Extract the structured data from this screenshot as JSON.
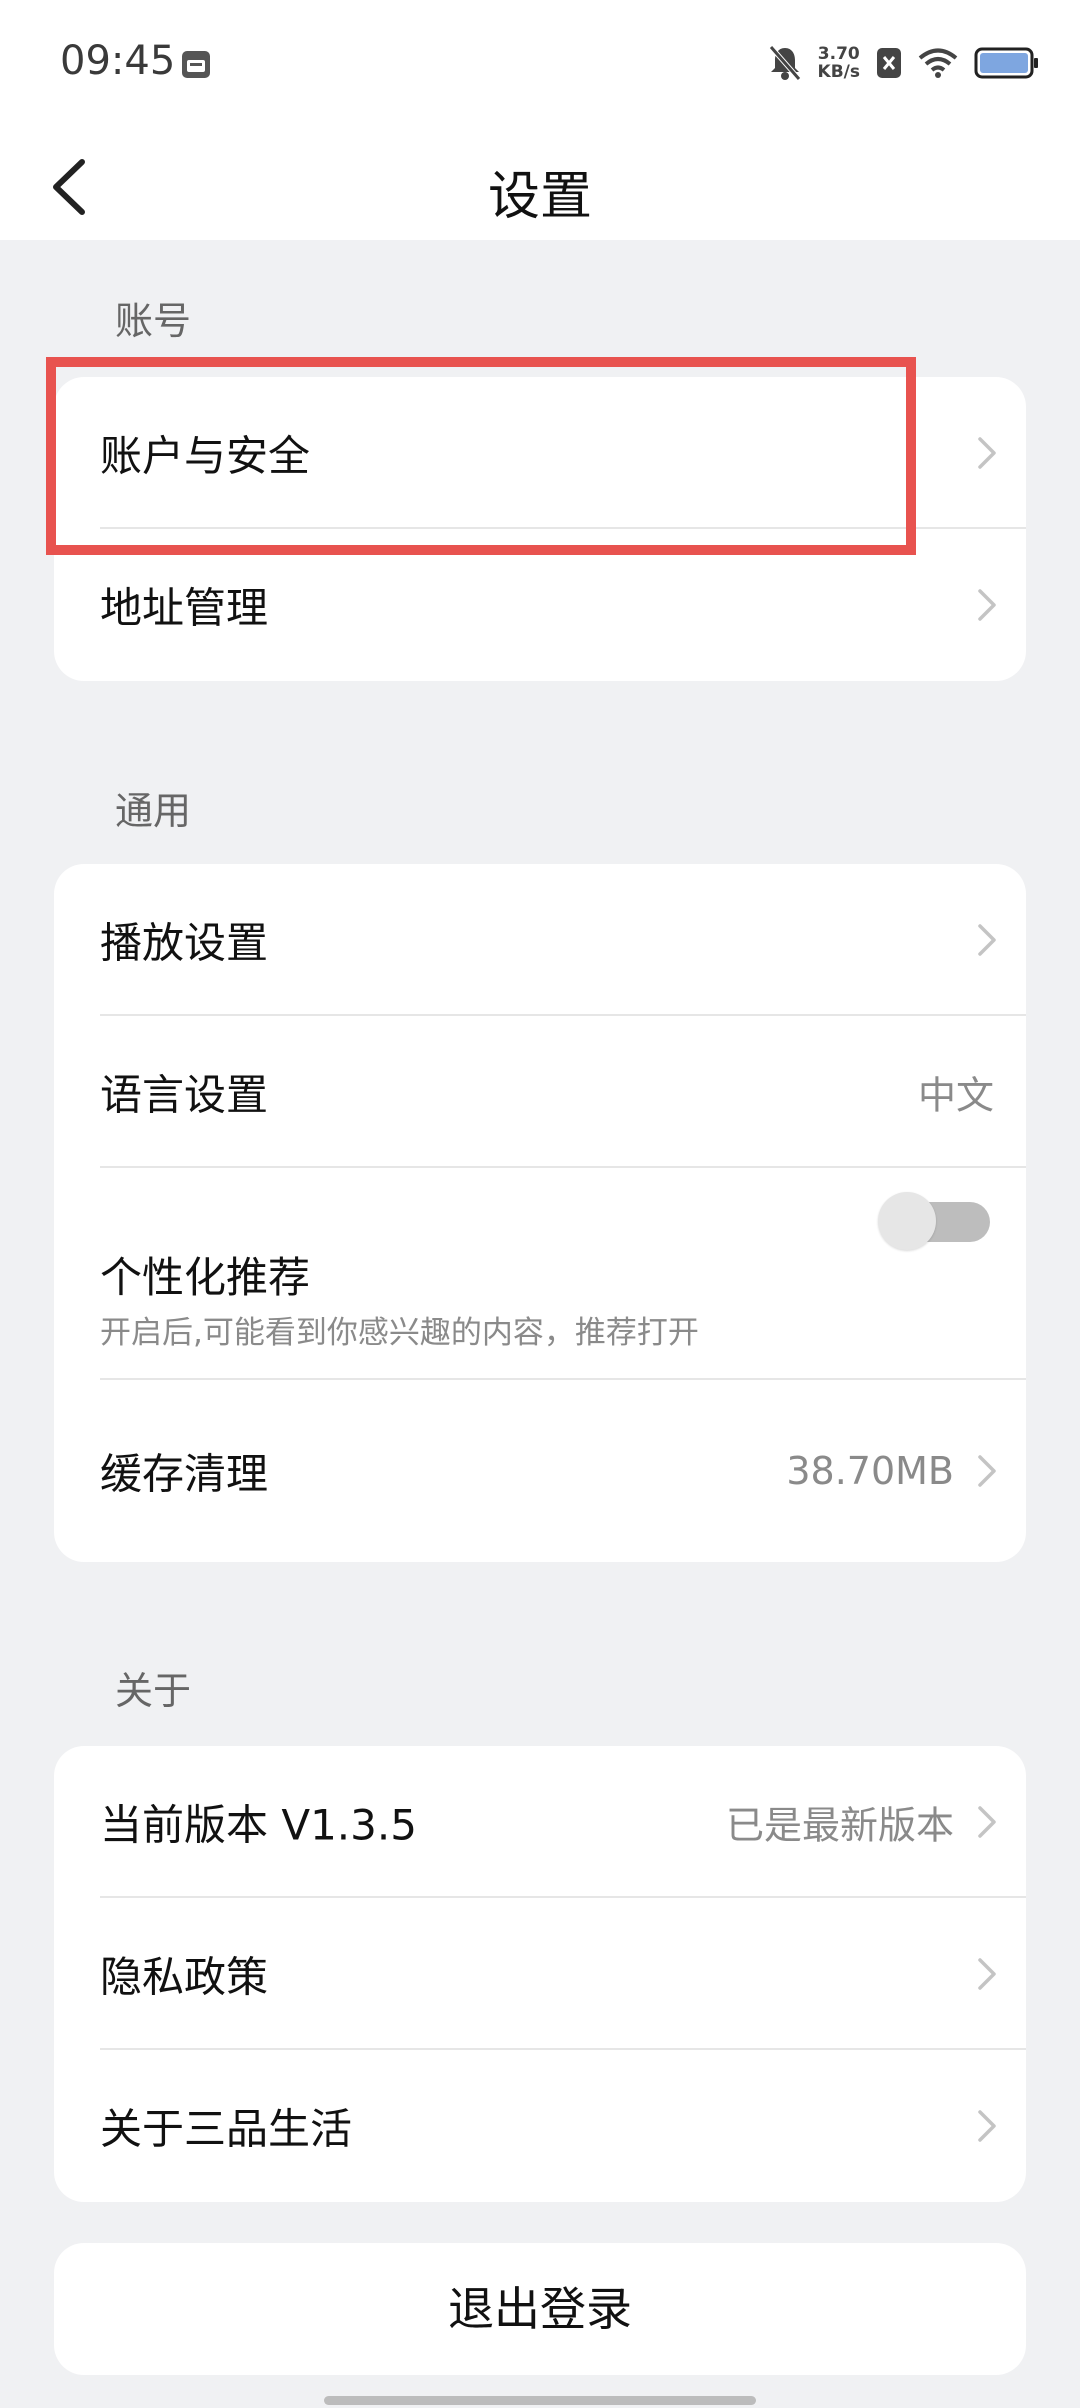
{
  "status_bar": {
    "time": "09:45",
    "network_speed_value": "3.70",
    "network_speed_unit": "KB/s",
    "icons": [
      "calendar-icon",
      "mute-bell-icon",
      "sim-x-icon",
      "wifi-icon",
      "battery-icon"
    ]
  },
  "nav": {
    "back_icon": "chevron-left-icon",
    "title": "设置"
  },
  "sections": {
    "account": {
      "label": "账号",
      "items": [
        {
          "label": "账户与安全"
        },
        {
          "label": "地址管理"
        }
      ]
    },
    "general": {
      "label": "通用",
      "items": [
        {
          "label": "播放设置"
        },
        {
          "label": "语言设置",
          "value": "中文"
        },
        {
          "label": "个性化推荐",
          "sub": "开启后,可能看到你感兴趣的内容，推荐打开",
          "toggle_on": false
        },
        {
          "label": "缓存清理",
          "value": "38.70MB"
        }
      ]
    },
    "about": {
      "label": "关于",
      "items": [
        {
          "label": "当前版本 V1.3.5",
          "value": "已是最新版本"
        },
        {
          "label": "隐私政策"
        },
        {
          "label": "关于三品生活"
        }
      ]
    }
  },
  "logout_label": "退出登录",
  "colors": {
    "highlight": "#e8534f",
    "background": "#f0f1f3",
    "card": "#ffffff"
  }
}
